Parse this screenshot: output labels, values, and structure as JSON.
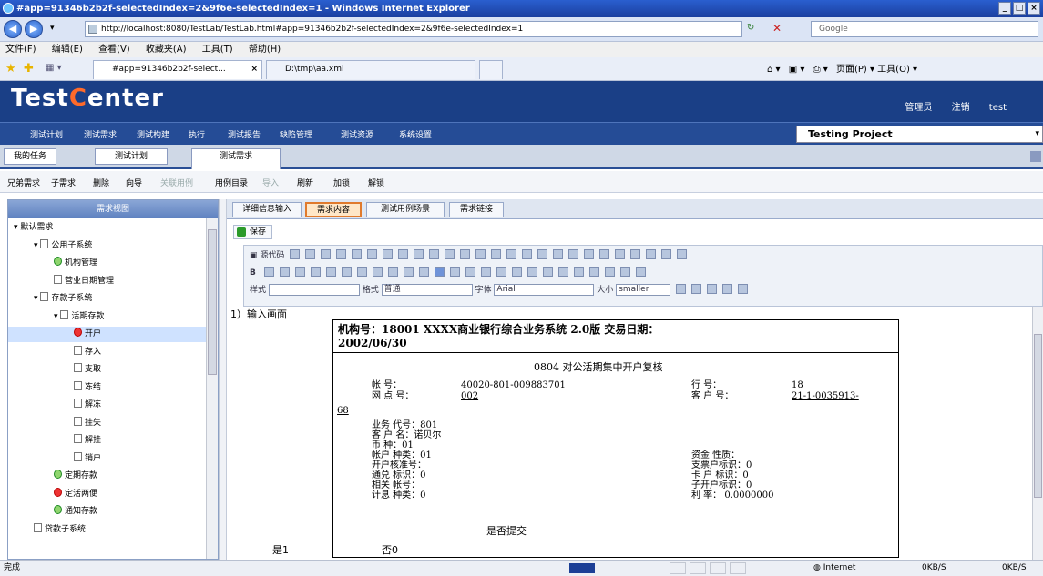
{
  "window": {
    "title": "#app=91346b2b2f-selectedIndex=2&9f6e-selectedIndex=1 - Windows Internet Explorer",
    "controls": [
      "_",
      "□",
      "×"
    ]
  },
  "addressbar": {
    "url": "http://localhost:8080/TestLab/TestLab.html#app=91346b2b2f-selectedIndex=2&9f6e-selectedIndex=1",
    "search_placeholder": "Google"
  },
  "menubar": [
    "文件(F)",
    "编辑(E)",
    "查看(V)",
    "收藏夹(A)",
    "工具(T)",
    "帮助(H)"
  ],
  "ietabs": [
    {
      "label": "#app=91346b2b2f-select...",
      "close": "×"
    },
    {
      "label": "D:\\tmp\\aa.xml"
    }
  ],
  "commandbar": "页面(P) ▾  工具(O) ▾",
  "app": {
    "logo_a": "Test",
    "logo_b": "C",
    "logo_c": "enter",
    "user_items": [
      "管理员",
      "注销",
      "test"
    ]
  },
  "mainnav": [
    "测试计划",
    "测试需求",
    "测试构建",
    "执行",
    "测试报告",
    "缺陷管理",
    "测试资源",
    "系统设置"
  ],
  "project": "Testing Project",
  "subtabs": [
    "我的任务",
    "测试计划",
    "测试需求"
  ],
  "actions": [
    {
      "label": "兄弟需求",
      "enabled": true
    },
    {
      "label": "子需求",
      "enabled": true
    },
    {
      "label": "删除",
      "enabled": true
    },
    {
      "label": "向导",
      "enabled": true
    },
    {
      "label": "关联用例",
      "enabled": false
    },
    {
      "label": "用例目录",
      "enabled": true
    },
    {
      "label": "导入",
      "enabled": false
    },
    {
      "label": "刷新",
      "enabled": true
    },
    {
      "label": "加锁",
      "enabled": true
    },
    {
      "label": "解锁",
      "enabled": true
    }
  ],
  "leftpanel": {
    "title": "需求视图",
    "tree": [
      {
        "label": "▾ 默认需求",
        "level": 0,
        "icon": "none"
      },
      {
        "label": "公用子系统",
        "level": 1,
        "icon": "folder",
        "expander": "▾"
      },
      {
        "label": "机构管理",
        "level": 2,
        "icon": "green"
      },
      {
        "label": "营业日期管理",
        "level": 2,
        "icon": "folder"
      },
      {
        "label": "存款子系统",
        "level": 1,
        "icon": "folder",
        "expander": "▾"
      },
      {
        "label": "活期存款",
        "level": 2,
        "icon": "folder",
        "expander": "▾"
      },
      {
        "label": "开户",
        "level": 3,
        "icon": "red",
        "selected": true
      },
      {
        "label": "存入",
        "level": 3,
        "icon": "folder"
      },
      {
        "label": "支取",
        "level": 3,
        "icon": "folder"
      },
      {
        "label": "冻结",
        "level": 3,
        "icon": "folder"
      },
      {
        "label": "解冻",
        "level": 3,
        "icon": "folder"
      },
      {
        "label": "挂失",
        "level": 3,
        "icon": "folder"
      },
      {
        "label": "解挂",
        "level": 3,
        "icon": "folder"
      },
      {
        "label": "销户",
        "level": 3,
        "icon": "folder"
      },
      {
        "label": "定期存款",
        "level": 2,
        "icon": "green"
      },
      {
        "label": "定活两便",
        "level": 2,
        "icon": "red"
      },
      {
        "label": "通知存款",
        "level": 2,
        "icon": "green"
      },
      {
        "label": "贷款子系统",
        "level": 1,
        "icon": "folder"
      }
    ]
  },
  "righttabs": [
    "详细信息输入",
    "需求内容",
    "测试用例场景",
    "需求链接"
  ],
  "save_label": "保存",
  "editor": {
    "row1": "源代码",
    "style_label": "样式",
    "format_label": "格式",
    "format_value": "普通",
    "font_label": "字体",
    "font_value": "Arial",
    "size_label": "大小",
    "size_value": "smaller"
  },
  "document": {
    "heading": "1）输入画面",
    "receipt_line1": "机构号：18001    XXXX商业银行综合业务系统 2.0版    交易日期：",
    "receipt_line2": "2002/06/30",
    "title": "0804  对公活期集中开户复核",
    "fields": {
      "acct_label": "帐          号：",
      "acct_value": "40020-801-009883701",
      "bank_label": "行          号：",
      "bank_value": "18",
      "branch_label": "网    点    号：",
      "branch_value": "002",
      "cust_label": "客    户    号：",
      "cust_value": "21-1-0035913-",
      "cust_cont": "68",
      "bizcode": "业务  代号：801",
      "custname": "客    户    名：诺贝尔",
      "currency": "币          种：01",
      "accttype": "帐户  种类：01",
      "approval": "开户核准号：",
      "exchange": "通兑  标识：0",
      "related": "相关  帐号：        _        _",
      "interest": "计息  种类：0",
      "fundtype": "资金  性质：",
      "chequeflag": "支票户标识：0",
      "cardflag": "卡  户  标识：0",
      "subacct": "子开户标识：0",
      "rate": "利          率：   0.0000000"
    },
    "submit_question": "是否提交",
    "yes": "是1",
    "no": "否0"
  },
  "status": {
    "left": "完成",
    "zone": "Internet",
    "rate1": "0KB/S",
    "rate2": "0KB/S"
  }
}
